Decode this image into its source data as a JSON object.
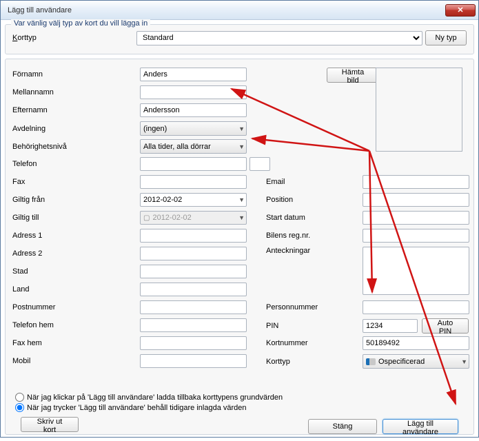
{
  "window": {
    "title": "Lägg till användare",
    "close_label": "X"
  },
  "top_group": {
    "legend": "Var vänlig välj typ av kort du vill lägga in",
    "korttyp_label": "Korttyp",
    "korttyp_value": "Standard",
    "ny_typ_button": "Ny typ"
  },
  "form": {
    "fornamn_label": "Förnamn",
    "fornamn_value": "Anders",
    "mellannamn_label": "Mellannamn",
    "mellannamn_value": "",
    "efternamn_label": "Efternamn",
    "efternamn_value": "Andersson",
    "avdelning_label": "Avdelning",
    "avdelning_value": "(ingen)",
    "behorig_label": "Behörighetsnivå",
    "behorig_value": "Alla tider, alla dörrar",
    "telefon_label": "Telefon",
    "telefon_value": "",
    "telefon_ext_value": "",
    "fax_label": "Fax",
    "fax_value": "",
    "giltig_fran_label": "Giltig från",
    "giltig_fran_value": "2012-02-02",
    "giltig_till_label": "Giltig till",
    "giltig_till_value": "2012-02-02",
    "adress1_label": "Adress 1",
    "adress1_value": "",
    "adress2_label": "Adress 2",
    "adress2_value": "",
    "stad_label": "Stad",
    "stad_value": "",
    "land_label": "Land",
    "land_value": "",
    "postnummer_label": "Postnummer",
    "postnummer_value": "",
    "telefon_hem_label": "Telefon hem",
    "telefon_hem_value": "",
    "fax_hem_label": "Fax hem",
    "fax_hem_value": "",
    "mobil_label": "Mobil",
    "mobil_value": "",
    "email_label": "Email",
    "email_value": "",
    "position_label": "Position",
    "position_value": "",
    "start_datum_label": "Start datum",
    "start_datum_value": "",
    "bilens_reg_label": "Bilens reg.nr.",
    "bilens_reg_value": "",
    "anteckningar_label": "Anteckningar",
    "anteckningar_value": "",
    "personnummer_label": "Personnummer",
    "personnummer_value": "",
    "pin_label": "PIN",
    "pin_value": "1234",
    "auto_pin_button": "Auto PIN",
    "kortnummer_label": "Kortnummer",
    "kortnummer_value": "50189492",
    "korttyp2_label": "Korttyp",
    "korttyp2_value": "Ospecificerad"
  },
  "hamta_bild_button": "Hämta bild",
  "radios": {
    "option1": "När jag klickar på 'Lägg till användare' ladda tillbaka korttypens grundvärden",
    "option2": "När jag trycker 'Lägg till användare' behåll tidigare inlagda värden"
  },
  "buttons": {
    "skriv_ut": "Skriv ut kort",
    "stang": "Stäng",
    "lagg_till": "Lägg till användare"
  }
}
